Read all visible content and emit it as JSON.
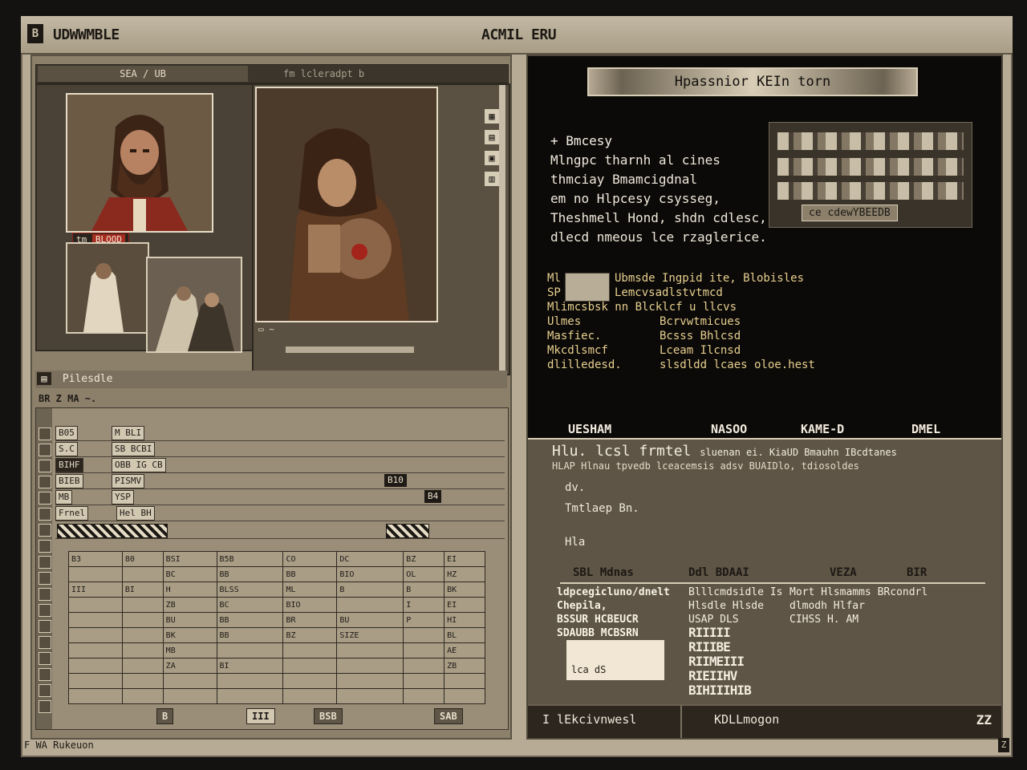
{
  "titlebar": {
    "icon": "B",
    "app_name": "UDWWMBLE",
    "title": "ACMIL ERU"
  },
  "left": {
    "tabs": [
      "SEA / UB",
      "fm  lcleradpt b"
    ],
    "portrait_tag": "tm",
    "portrait_tag_red": "BLOOD",
    "side_icons": [
      "▦",
      "▤",
      "▣",
      "▥"
    ],
    "detail_caption": "▭ ~",
    "section_title": "Pilesdle",
    "sub_header": "BR Z MA ~.",
    "rows": [
      {
        "cells": [
          "B05",
          "M  BLI"
        ],
        "badge": ""
      },
      {
        "cells": [
          "S.C",
          "SB  BCBI"
        ],
        "badge": ""
      },
      {
        "cells": [
          "BIHF",
          "OBB IG CB"
        ],
        "badge": ""
      },
      {
        "cells": [
          "BIEB",
          "PISMV"
        ],
        "badge": "B10"
      },
      {
        "cells": [
          "MB",
          "YSP"
        ],
        "badge": "B4"
      },
      {
        "cells": [
          "Frnel",
          "Hel  BH"
        ],
        "badge": ""
      }
    ],
    "sheet_rows": [
      [
        "B3",
        "80",
        "BSI",
        "B5B",
        "CO",
        "DC",
        "BZ",
        "EI"
      ],
      [
        "",
        "",
        "BC",
        "BB",
        "BB",
        "BIO",
        "OL",
        "HZ"
      ],
      [
        "III",
        "BI",
        "H",
        "BLSS",
        "ML",
        "B",
        "B",
        "BK"
      ],
      [
        "",
        "",
        "ZB",
        "BC",
        "BIO",
        "",
        "I",
        "EI"
      ],
      [
        "",
        "",
        "BU",
        "BB",
        "BR",
        "BU",
        "P",
        "HI"
      ],
      [
        "",
        "",
        "BK",
        "BB",
        "BZ",
        "SIZE",
        "",
        "BL"
      ],
      [
        "",
        "",
        "MB",
        "",
        "",
        "",
        "",
        "AE"
      ],
      [
        "",
        "",
        "ZA",
        "BI",
        "",
        "",
        "",
        "ZB"
      ],
      [
        "",
        "",
        "",
        "",
        "",
        "",
        "",
        ""
      ],
      [
        "",
        "",
        "",
        "",
        "",
        "",
        "",
        ""
      ]
    ],
    "strip_buttons": [
      "B",
      "III",
      "BSB",
      "SAB"
    ]
  },
  "right": {
    "banner": "Hpassnior KEIn torn",
    "summary_head": "+ Bmcesy",
    "summary_lines": [
      "Mlngpc tharnh al cines",
      "thmciay Bmamcigdnal",
      "em no Hlpcesy csysseg,",
      "Theshmell Hond, shdn cdlesc,",
      "dlecd nmeous lce rzaglerice."
    ],
    "strip_label": "ce cdewYBEEDB",
    "info": {
      "row1_left": "Ml",
      "row1_right": "Ubmsde Ingpid ite, Blobisles",
      "row2_left": "SP",
      "row2_right": "Lemcvsadlstvtmcd",
      "row3": "Mlimcsbsk nn Blcklcf u llcvs",
      "col_a": [
        "Ulmes",
        "Masfiec.",
        "Mkcdlsmcf",
        "dlilledesd."
      ],
      "col_b": [
        "Bcrvwtmicues",
        "Bcsss Bhlcsd",
        "Lceam Ilcnsd",
        "slsdldd lcaes oloe.hest"
      ]
    },
    "columns": [
      "UESHAM",
      "NASOO",
      "KAME-D",
      "DMEL"
    ],
    "lower_title": "Hlu. lcsl frmtel",
    "lower_title_tail": "sluenan ei. KiaUD Bmauhn IBcdtanes",
    "lower_sub": "HLAP Hlnau tpvedb lceacemsis adsv BUAIDlo, tdiosoldes",
    "lower_lines": [
      "dv.",
      "Tmtlaep Bn.",
      "Hla"
    ],
    "table2_headers": [
      "SBL Mdnas",
      "Ddl BDAAI",
      "VEZA",
      "BIR"
    ],
    "table2_col1": [
      "ldpcegicluno/dnelt",
      "Chepila,",
      "BSSUR HCBEUCR",
      "SDAUBB MCBSRN"
    ],
    "table2_col2": [
      "Blllcmdsidle Is",
      "Hlsdle Hlsde",
      "USAP DLS"
    ],
    "table2_col3": [
      "Mort Hlsmamms BRcondrl",
      "dlmodh Hlfar",
      "CIHSS H. AM"
    ],
    "note_value": "lca   dS",
    "block_letters": [
      "RIIIII",
      "RIIIBE",
      "RIIMEIII",
      "RIEIIHV",
      "BIHIIIHIB"
    ],
    "status_left": "I lEkcivnwesl",
    "status_mid": "KDLLmogon",
    "corner_badge": "ZZ"
  },
  "footer": {
    "text": "F WA Rukeuon",
    "icon": "Z"
  }
}
